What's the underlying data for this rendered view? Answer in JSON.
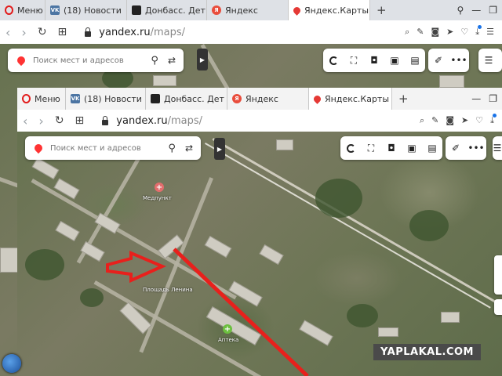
{
  "outer": {
    "tabs": [
      {
        "label": "Меню",
        "icon": "opera-logo-icon"
      },
      {
        "label": "(18) Новости",
        "icon": "vk-icon"
      },
      {
        "label": "Донбасс. Дет",
        "icon": "donbass-icon"
      },
      {
        "label": "Яндекс",
        "icon": "yandex-icon"
      },
      {
        "label": "Яндекс.Карты",
        "icon": "map-pin-icon",
        "active": true
      }
    ],
    "url_host": "yandex.ru",
    "url_path": "/maps/",
    "search_placeholder": "Поиск мест и адресов"
  },
  "inner": {
    "tabs": [
      {
        "label": "Меню",
        "icon": "opera-logo-icon"
      },
      {
        "label": "(18) Новости",
        "icon": "vk-icon"
      },
      {
        "label": "Донбасс. Дет",
        "icon": "donbass-icon"
      },
      {
        "label": "Яндекс",
        "icon": "yandex-icon"
      },
      {
        "label": "Яндекс.Карты",
        "icon": "map-pin-icon",
        "active": true
      }
    ],
    "url_host": "yandex.ru",
    "url_path": "/maps/",
    "search_placeholder": "Поиск мест и адресов"
  },
  "map_labels": {
    "med": "Медпункт",
    "bus": "Площадь Ленина",
    "pharmacy": "Аптека"
  },
  "watermark": "YAPLAKAL.COM",
  "colors": {
    "accent_red": "#e21b1b",
    "arrow_red": "#e8201c"
  }
}
